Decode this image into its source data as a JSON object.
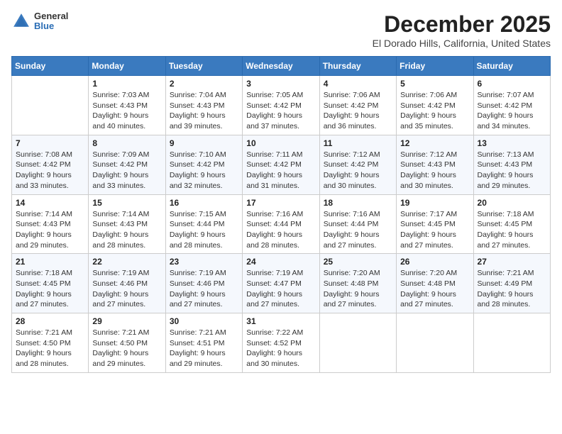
{
  "header": {
    "logo_general": "General",
    "logo_blue": "Blue",
    "month_title": "December 2025",
    "location": "El Dorado Hills, California, United States"
  },
  "days_of_week": [
    "Sunday",
    "Monday",
    "Tuesday",
    "Wednesday",
    "Thursday",
    "Friday",
    "Saturday"
  ],
  "weeks": [
    [
      {
        "day": "",
        "sunrise": "",
        "sunset": "",
        "daylight": ""
      },
      {
        "day": "1",
        "sunrise": "Sunrise: 7:03 AM",
        "sunset": "Sunset: 4:43 PM",
        "daylight": "Daylight: 9 hours and 40 minutes."
      },
      {
        "day": "2",
        "sunrise": "Sunrise: 7:04 AM",
        "sunset": "Sunset: 4:43 PM",
        "daylight": "Daylight: 9 hours and 39 minutes."
      },
      {
        "day": "3",
        "sunrise": "Sunrise: 7:05 AM",
        "sunset": "Sunset: 4:42 PM",
        "daylight": "Daylight: 9 hours and 37 minutes."
      },
      {
        "day": "4",
        "sunrise": "Sunrise: 7:06 AM",
        "sunset": "Sunset: 4:42 PM",
        "daylight": "Daylight: 9 hours and 36 minutes."
      },
      {
        "day": "5",
        "sunrise": "Sunrise: 7:06 AM",
        "sunset": "Sunset: 4:42 PM",
        "daylight": "Daylight: 9 hours and 35 minutes."
      },
      {
        "day": "6",
        "sunrise": "Sunrise: 7:07 AM",
        "sunset": "Sunset: 4:42 PM",
        "daylight": "Daylight: 9 hours and 34 minutes."
      }
    ],
    [
      {
        "day": "7",
        "sunrise": "Sunrise: 7:08 AM",
        "sunset": "Sunset: 4:42 PM",
        "daylight": "Daylight: 9 hours and 33 minutes."
      },
      {
        "day": "8",
        "sunrise": "Sunrise: 7:09 AM",
        "sunset": "Sunset: 4:42 PM",
        "daylight": "Daylight: 9 hours and 33 minutes."
      },
      {
        "day": "9",
        "sunrise": "Sunrise: 7:10 AM",
        "sunset": "Sunset: 4:42 PM",
        "daylight": "Daylight: 9 hours and 32 minutes."
      },
      {
        "day": "10",
        "sunrise": "Sunrise: 7:11 AM",
        "sunset": "Sunset: 4:42 PM",
        "daylight": "Daylight: 9 hours and 31 minutes."
      },
      {
        "day": "11",
        "sunrise": "Sunrise: 7:12 AM",
        "sunset": "Sunset: 4:42 PM",
        "daylight": "Daylight: 9 hours and 30 minutes."
      },
      {
        "day": "12",
        "sunrise": "Sunrise: 7:12 AM",
        "sunset": "Sunset: 4:43 PM",
        "daylight": "Daylight: 9 hours and 30 minutes."
      },
      {
        "day": "13",
        "sunrise": "Sunrise: 7:13 AM",
        "sunset": "Sunset: 4:43 PM",
        "daylight": "Daylight: 9 hours and 29 minutes."
      }
    ],
    [
      {
        "day": "14",
        "sunrise": "Sunrise: 7:14 AM",
        "sunset": "Sunset: 4:43 PM",
        "daylight": "Daylight: 9 hours and 29 minutes."
      },
      {
        "day": "15",
        "sunrise": "Sunrise: 7:14 AM",
        "sunset": "Sunset: 4:43 PM",
        "daylight": "Daylight: 9 hours and 28 minutes."
      },
      {
        "day": "16",
        "sunrise": "Sunrise: 7:15 AM",
        "sunset": "Sunset: 4:44 PM",
        "daylight": "Daylight: 9 hours and 28 minutes."
      },
      {
        "day": "17",
        "sunrise": "Sunrise: 7:16 AM",
        "sunset": "Sunset: 4:44 PM",
        "daylight": "Daylight: 9 hours and 28 minutes."
      },
      {
        "day": "18",
        "sunrise": "Sunrise: 7:16 AM",
        "sunset": "Sunset: 4:44 PM",
        "daylight": "Daylight: 9 hours and 27 minutes."
      },
      {
        "day": "19",
        "sunrise": "Sunrise: 7:17 AM",
        "sunset": "Sunset: 4:45 PM",
        "daylight": "Daylight: 9 hours and 27 minutes."
      },
      {
        "day": "20",
        "sunrise": "Sunrise: 7:18 AM",
        "sunset": "Sunset: 4:45 PM",
        "daylight": "Daylight: 9 hours and 27 minutes."
      }
    ],
    [
      {
        "day": "21",
        "sunrise": "Sunrise: 7:18 AM",
        "sunset": "Sunset: 4:45 PM",
        "daylight": "Daylight: 9 hours and 27 minutes."
      },
      {
        "day": "22",
        "sunrise": "Sunrise: 7:19 AM",
        "sunset": "Sunset: 4:46 PM",
        "daylight": "Daylight: 9 hours and 27 minutes."
      },
      {
        "day": "23",
        "sunrise": "Sunrise: 7:19 AM",
        "sunset": "Sunset: 4:46 PM",
        "daylight": "Daylight: 9 hours and 27 minutes."
      },
      {
        "day": "24",
        "sunrise": "Sunrise: 7:19 AM",
        "sunset": "Sunset: 4:47 PM",
        "daylight": "Daylight: 9 hours and 27 minutes."
      },
      {
        "day": "25",
        "sunrise": "Sunrise: 7:20 AM",
        "sunset": "Sunset: 4:48 PM",
        "daylight": "Daylight: 9 hours and 27 minutes."
      },
      {
        "day": "26",
        "sunrise": "Sunrise: 7:20 AM",
        "sunset": "Sunset: 4:48 PM",
        "daylight": "Daylight: 9 hours and 27 minutes."
      },
      {
        "day": "27",
        "sunrise": "Sunrise: 7:21 AM",
        "sunset": "Sunset: 4:49 PM",
        "daylight": "Daylight: 9 hours and 28 minutes."
      }
    ],
    [
      {
        "day": "28",
        "sunrise": "Sunrise: 7:21 AM",
        "sunset": "Sunset: 4:50 PM",
        "daylight": "Daylight: 9 hours and 28 minutes."
      },
      {
        "day": "29",
        "sunrise": "Sunrise: 7:21 AM",
        "sunset": "Sunset: 4:50 PM",
        "daylight": "Daylight: 9 hours and 29 minutes."
      },
      {
        "day": "30",
        "sunrise": "Sunrise: 7:21 AM",
        "sunset": "Sunset: 4:51 PM",
        "daylight": "Daylight: 9 hours and 29 minutes."
      },
      {
        "day": "31",
        "sunrise": "Sunrise: 7:22 AM",
        "sunset": "Sunset: 4:52 PM",
        "daylight": "Daylight: 9 hours and 30 minutes."
      },
      {
        "day": "",
        "sunrise": "",
        "sunset": "",
        "daylight": ""
      },
      {
        "day": "",
        "sunrise": "",
        "sunset": "",
        "daylight": ""
      },
      {
        "day": "",
        "sunrise": "",
        "sunset": "",
        "daylight": ""
      }
    ]
  ]
}
